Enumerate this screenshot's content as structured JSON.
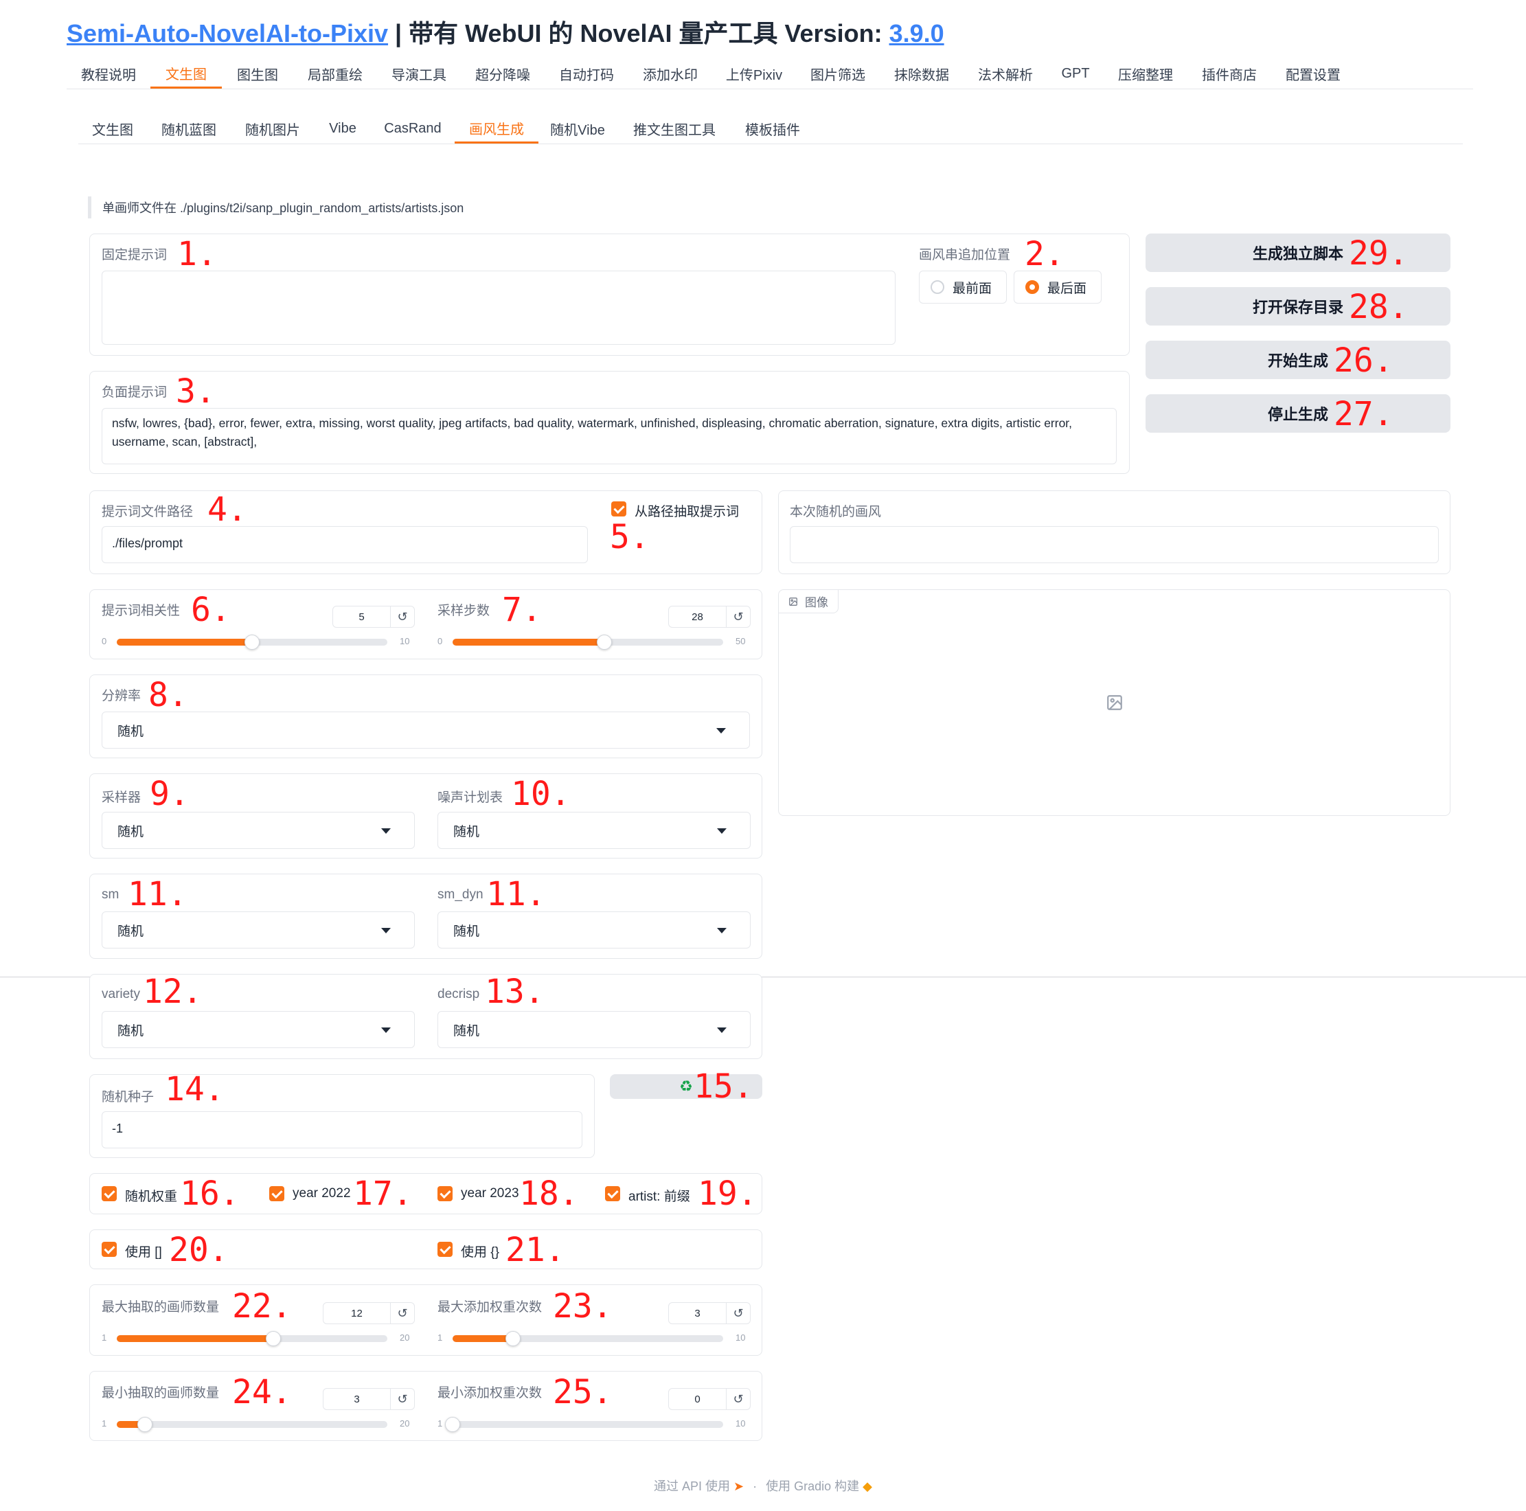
{
  "header": {
    "link_text": "Semi-Auto-NovelAI-to-Pixiv",
    "title_rest": " | 带有 WebUI 的 NovelAI 量产工具 Version: ",
    "version": "3.9.0"
  },
  "main_tabs": [
    "教程说明",
    "文生图",
    "图生图",
    "局部重绘",
    "导演工具",
    "超分降噪",
    "自动打码",
    "添加水印",
    "上传Pixiv",
    "图片筛选",
    "抹除数据",
    "法术解析",
    "GPT",
    "压缩整理",
    "插件商店",
    "配置设置"
  ],
  "main_tab_active": "文生图",
  "sub_tabs": [
    "文生图",
    "随机蓝图",
    "随机图片",
    "Vibe",
    "CasRand",
    "画风生成",
    "随机Vibe",
    "推文生图工具",
    "模板插件"
  ],
  "sub_tab_active": "画风生成",
  "info_text": "单画师文件在 ./plugins/t2i/sanp_plugin_random_artists/artists.json",
  "fixed_prompt": {
    "label": "固定提示词",
    "value": "",
    "marker": "1."
  },
  "position": {
    "label": "画风串追加位置",
    "options": [
      "最前面",
      "最后面"
    ],
    "selected": "最后面",
    "marker": "2."
  },
  "negative": {
    "label": "负面提示词",
    "value": "nsfw, lowres, {bad}, error, fewer, extra, missing, worst quality, jpeg artifacts, bad quality, watermark, unfinished, displeasing, chromatic aberration, signature, extra digits, artistic error, username, scan, [abstract],",
    "marker": "3."
  },
  "buttons": [
    {
      "label": "生成独立脚本",
      "marker": "29."
    },
    {
      "label": "打开保存目录",
      "marker": "28."
    },
    {
      "label": "开始生成",
      "marker": "26."
    },
    {
      "label": "停止生成",
      "marker": "27."
    }
  ],
  "prompt_path": {
    "label": "提示词文件路径",
    "value": "./files/prompt",
    "marker": "4."
  },
  "extract_checkbox": {
    "label": "从路径抽取提示词",
    "checked": true,
    "marker": "5."
  },
  "current_style": {
    "label": "本次随机的画风",
    "value": ""
  },
  "image": {
    "label": "图像"
  },
  "sliders": {
    "cfg": {
      "label": "提示词相关性",
      "value": "5",
      "min": "0",
      "max": "10",
      "fraction": 0.5,
      "marker": "6."
    },
    "steps": {
      "label": "采样步数",
      "value": "28",
      "min": "0",
      "max": "50",
      "fraction": 0.56,
      "marker": "7."
    },
    "max_artists": {
      "label": "最大抽取的画师数量",
      "value": "12",
      "min": "1",
      "max": "20",
      "fraction": 0.5789,
      "marker": "22."
    },
    "max_weight": {
      "label": "最大添加权重次数",
      "value": "3",
      "min": "1",
      "max": "10",
      "fraction": 0.2222,
      "marker": "23."
    },
    "min_artists": {
      "label": "最小抽取的画师数量",
      "value": "3",
      "min": "1",
      "max": "20",
      "fraction": 0.1053,
      "marker": "24."
    },
    "min_weight": {
      "label": "最小添加权重次数",
      "value": "0",
      "min": "1",
      "max": "10",
      "fraction": 0.0,
      "marker": "25."
    }
  },
  "dropdowns": {
    "resolution": {
      "label": "分辨率",
      "value": "随机",
      "marker": "8."
    },
    "sampler": {
      "label": "采样器",
      "value": "随机",
      "marker": "9."
    },
    "noise": {
      "label": "噪声计划表",
      "value": "随机",
      "marker": "10."
    },
    "sm": {
      "label": "sm",
      "value": "随机",
      "marker": "11."
    },
    "sm_dyn": {
      "label": "sm_dyn",
      "value": "随机",
      "marker": "11."
    },
    "variety": {
      "label": "variety",
      "value": "随机",
      "marker": "12."
    },
    "decrisp": {
      "label": "decrisp",
      "value": "随机",
      "marker": "13."
    }
  },
  "seed": {
    "label": "随机种子",
    "value": "-1",
    "marker": "14."
  },
  "recycle": {
    "icon": "♻",
    "marker": "15."
  },
  "checks_row1": [
    {
      "label": "随机权重",
      "checked": true,
      "marker": "16."
    },
    {
      "label": "year 2022",
      "checked": true,
      "marker": "17."
    },
    {
      "label": "year 2023",
      "checked": true,
      "marker": "18."
    },
    {
      "label": "artist: 前缀",
      "checked": true,
      "marker": "19."
    }
  ],
  "checks_row2": [
    {
      "label": "使用 []",
      "checked": true,
      "marker": "20."
    },
    {
      "label": "使用 {}",
      "checked": true,
      "marker": "21."
    }
  ],
  "footer": {
    "api": "通过 API 使用",
    "sep": "·",
    "built": "使用 Gradio 构建"
  },
  "colors": {
    "accent": "#f97316",
    "marker": "#ff1a1a",
    "link": "#3b82f6"
  }
}
